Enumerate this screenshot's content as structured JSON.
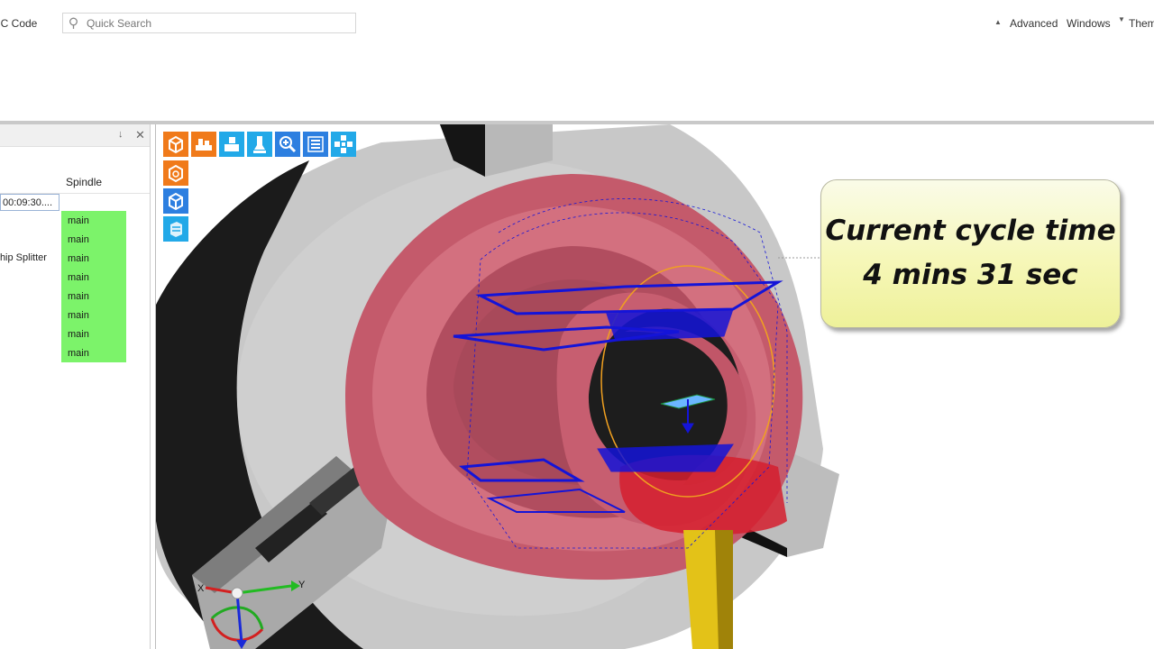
{
  "topbar": {
    "nc_tab_label": "NC Code",
    "search_placeholder": "Quick Search",
    "advanced_label": "Advanced",
    "windows_label": "Windows",
    "theme_label": "Theme"
  },
  "left_panel": {
    "column_header": "Spindle",
    "time_value": "00:09:30....",
    "operation_label": "Chip Splitter",
    "spindle_values": [
      "main",
      "main",
      "main",
      "main",
      "main",
      "main",
      "main",
      "main"
    ],
    "highlight_color": "#7cf36a"
  },
  "viewport_toolbar": {
    "icons": [
      "view-cube-icon",
      "machine-view-icon",
      "setup-view-icon",
      "tool-view-icon",
      "zoom-icon",
      "list-view-icon",
      "move-axes-icon",
      "part-view-icon",
      "stock-view-icon",
      "workpiece-view-icon"
    ]
  },
  "axis_triad": {
    "x_label": "X",
    "y_label": "Y"
  },
  "callout": {
    "line1": "Current cycle time",
    "line2": "4 mins 31 sec"
  },
  "colors": {
    "part": "#c65a6c",
    "chuck": "#c4c4c4",
    "toolpath": "#1414d8",
    "tool": "#e2c21a"
  }
}
